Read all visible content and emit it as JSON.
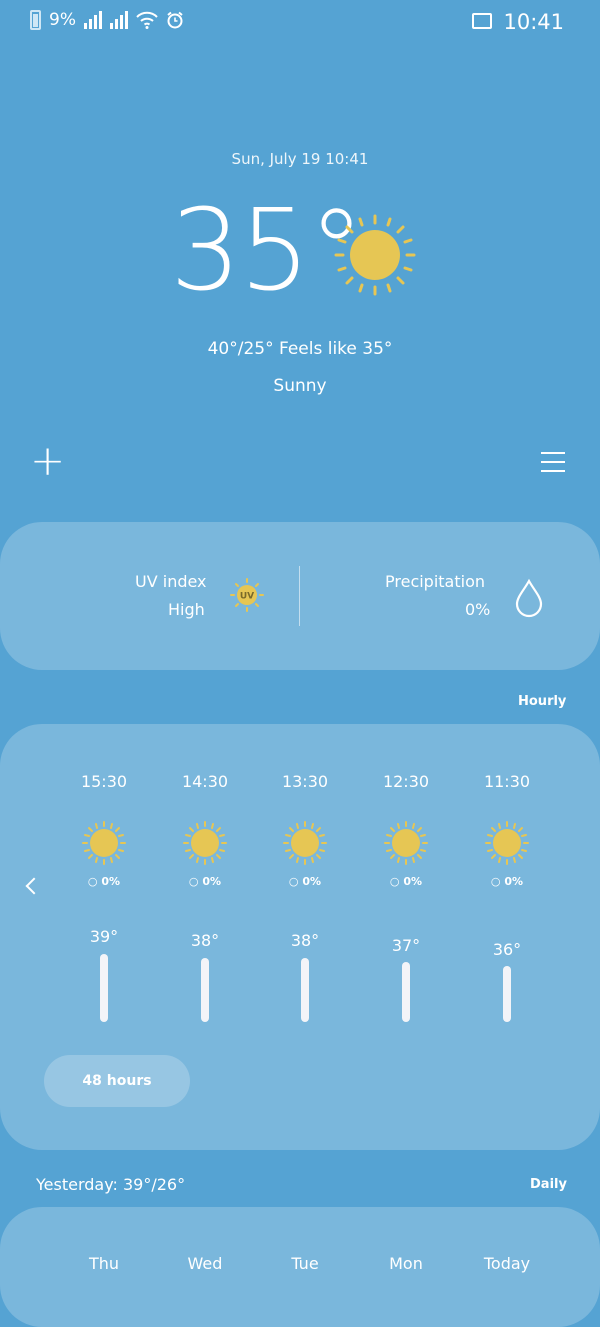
{
  "status_bar": {
    "time": "10:41",
    "battery": "9%",
    "icons": [
      "gallery-icon",
      "alarm-icon",
      "wifi-icon",
      "signal-icon",
      "battery-icon"
    ]
  },
  "header": {
    "date": "Sun, July 19 10:41",
    "temperature": "35°",
    "condition_icon": "sun-icon",
    "hi_lo_feels": "40°/25° Feels like 35°",
    "condition": "Sunny"
  },
  "toolbar": {
    "add_icon": "plus-icon",
    "menu_icon": "menu-icon"
  },
  "info": {
    "precipitation_label": "Precipitation",
    "precipitation_value": "0%",
    "uv_label": "UV index",
    "uv_value": "High",
    "uv_badge": "UV"
  },
  "hourly": {
    "title": "Hourly",
    "items": [
      {
        "time": "11:30",
        "precip": "0%",
        "temp": "36°"
      },
      {
        "time": "12:30",
        "precip": "0%",
        "temp": "37°"
      },
      {
        "time": "13:30",
        "precip": "0%",
        "temp": "38°"
      },
      {
        "time": "14:30",
        "precip": "0%",
        "temp": "38°"
      },
      {
        "time": "15:30",
        "precip": "0%",
        "temp": "39°"
      }
    ],
    "button_label": "48 hours"
  },
  "daily": {
    "title": "Daily",
    "yesterday": "Yesterday: 39°/26°",
    "days": [
      "Today",
      "Mon",
      "Tue",
      "Wed",
      "Thu"
    ]
  },
  "colors": {
    "background": "#55a3d3",
    "sun": "#e6c654",
    "card": "rgba(255,255,255,0.22)"
  }
}
